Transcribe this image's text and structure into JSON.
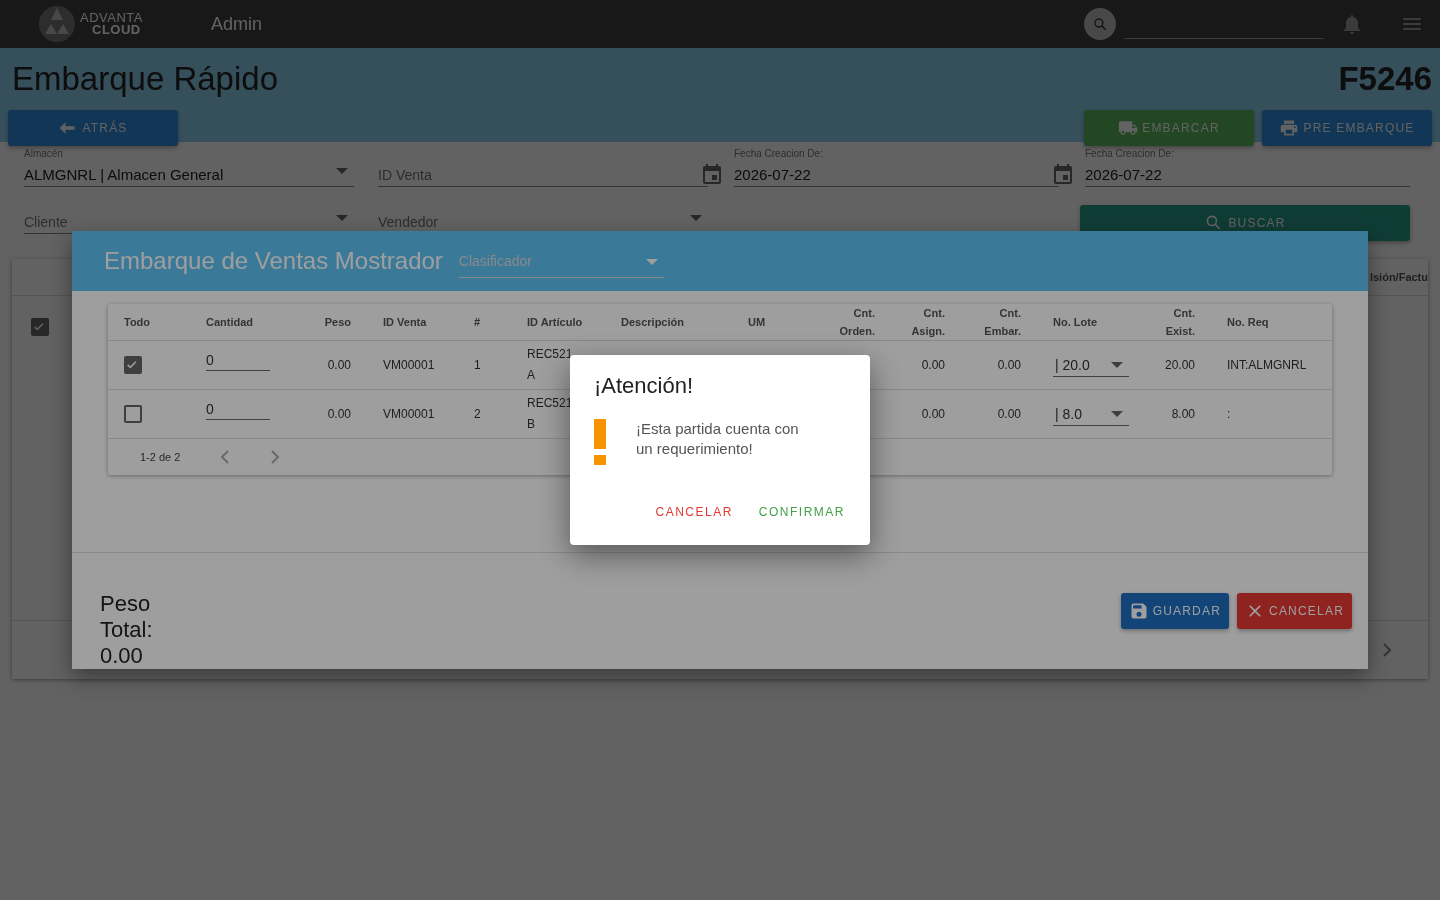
{
  "app_bar": {
    "logo_top": "ADVANTA",
    "logo_bottom": "CLOUD",
    "title": "Admin"
  },
  "page": {
    "title": "Embarque Rápido",
    "folio": "F5246",
    "buttons": [
      {
        "label": "ATRÁS",
        "kind": "back"
      },
      {
        "label": "EMBARCAR",
        "kind": "ship"
      },
      {
        "label": "PRE EMBARQUE",
        "kind": "print"
      }
    ],
    "filters": [
      {
        "kind": "select",
        "label": "Almacén",
        "value": "ALMGNRL | Almacen General"
      },
      {
        "kind": "text",
        "placeholder": "ID Venta"
      },
      {
        "kind": "date",
        "label": "Fecha Creacion De:",
        "value": "2026-07-22"
      },
      {
        "kind": "date",
        "label": "Fecha Creacion De:",
        "value": "2026-07-22"
      },
      {
        "kind": "select",
        "placeholder": "Cliente"
      },
      {
        "kind": "select",
        "placeholder": "Vendedor"
      }
    ],
    "search_button": "BUSCAR",
    "table": {
      "select_all_checked": true,
      "column_cut": "lsión/Factu"
    }
  },
  "modal": {
    "title": "Embarque de Ventas Mostrador",
    "classifier_placeholder": "Clasificador",
    "table": {
      "columns": [
        "Todo",
        "Cantidad",
        "Peso",
        "ID Venta",
        "#",
        "ID Artículo",
        "Descripción",
        "UM",
        "Cnt.\nOrden.",
        "Cnt.\nAsign.",
        "Cnt.\nEmbar.",
        "No. Lote",
        "Cnt.\nExist.",
        "No. Req"
      ],
      "rows": [
        {
          "checked": true,
          "cantidad": "0",
          "peso": "0.00",
          "id_venta": "VM00001",
          "num": "1",
          "id_articulo": "REC521",
          "id_articulo_line2": "A",
          "cnt_asign": "0.00",
          "cnt_embar": "0.00",
          "lote": "| 20.0",
          "cnt_exist": "20.00",
          "no_req": "INT:ALMGNRL"
        },
        {
          "checked": false,
          "cantidad": "0",
          "peso": "0.00",
          "id_venta": "VM00001",
          "num": "2",
          "id_articulo": "REC521",
          "id_articulo_line2": "B",
          "cnt_asign": "0.00",
          "cnt_embar": "0.00",
          "lote": "| 8.0",
          "cnt_exist": "8.00",
          "no_req": ":"
        }
      ],
      "pagination": "1-2 de 2"
    },
    "total_label": "Peso Total:",
    "total_value": "0.00",
    "buttons": [
      {
        "label": "GUARDAR",
        "kind": "save"
      },
      {
        "label": "CANCELAR",
        "kind": "cancel"
      }
    ]
  },
  "alert": {
    "title": "¡Atención!",
    "message": "¡Esta partida cuenta con un requerimiento!",
    "buttons": [
      {
        "label": "CANCELAR",
        "kind": "cancel"
      },
      {
        "label": "CONFIRMAR",
        "kind": "confirm"
      }
    ]
  }
}
